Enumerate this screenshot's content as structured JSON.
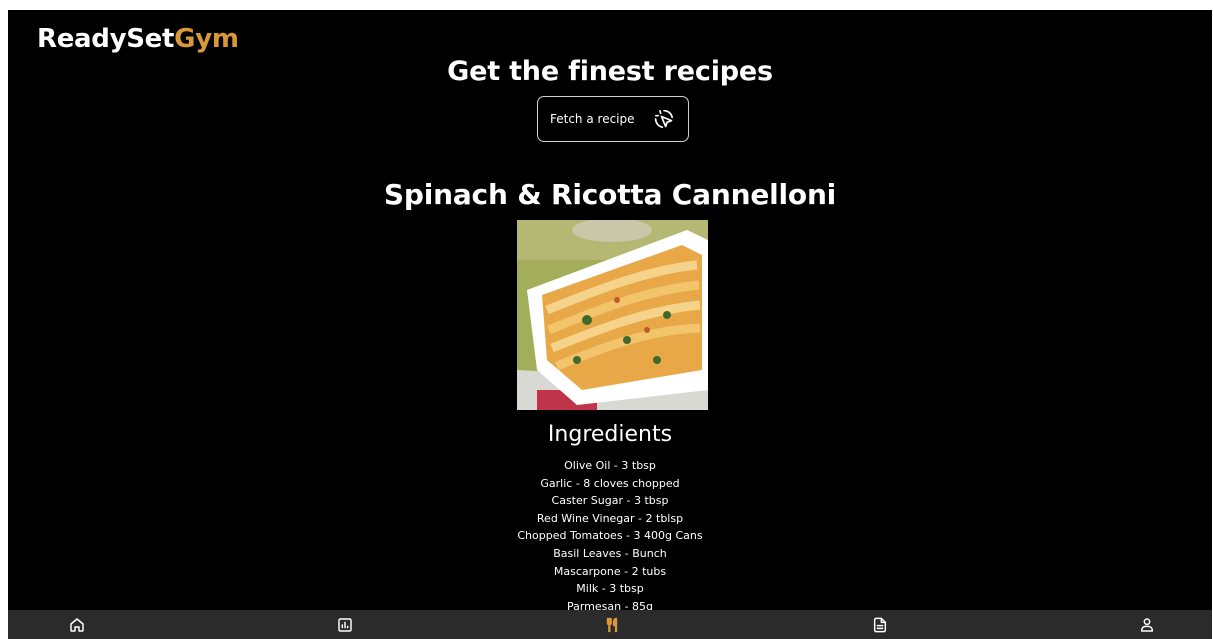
{
  "brand": {
    "part1": "ReadySet",
    "part2": "Gym",
    "accent_color": "#d9993a"
  },
  "hero": {
    "title": "Get the finest recipes"
  },
  "fetch_button": {
    "label": "Fetch a recipe",
    "icon": "cursor-click-icon"
  },
  "recipe": {
    "title": "Spinach & Ricotta Cannelloni",
    "ingredients_heading": "Ingredients",
    "ingredients": [
      "Olive Oil - 3 tbsp",
      "Garlic - 8 cloves chopped",
      "Caster Sugar - 3 tbsp",
      "Red Wine Vinegar - 2 tblsp",
      "Chopped Tomatoes - 3 400g Cans",
      "Basil Leaves - Bunch",
      "Mascarpone - 2 tubs",
      "Milk - 3 tbsp",
      "Parmesan - 85g"
    ]
  },
  "navbar": {
    "items": [
      {
        "name": "home",
        "icon": "home-icon",
        "active": false
      },
      {
        "name": "stats",
        "icon": "chart-icon",
        "active": false
      },
      {
        "name": "recipes",
        "icon": "fork-knife-icon",
        "active": true
      },
      {
        "name": "notes",
        "icon": "document-icon",
        "active": false
      },
      {
        "name": "profile",
        "icon": "user-icon",
        "active": false
      }
    ],
    "active_color": "#d9993a",
    "icon_color": "#ffffff"
  }
}
